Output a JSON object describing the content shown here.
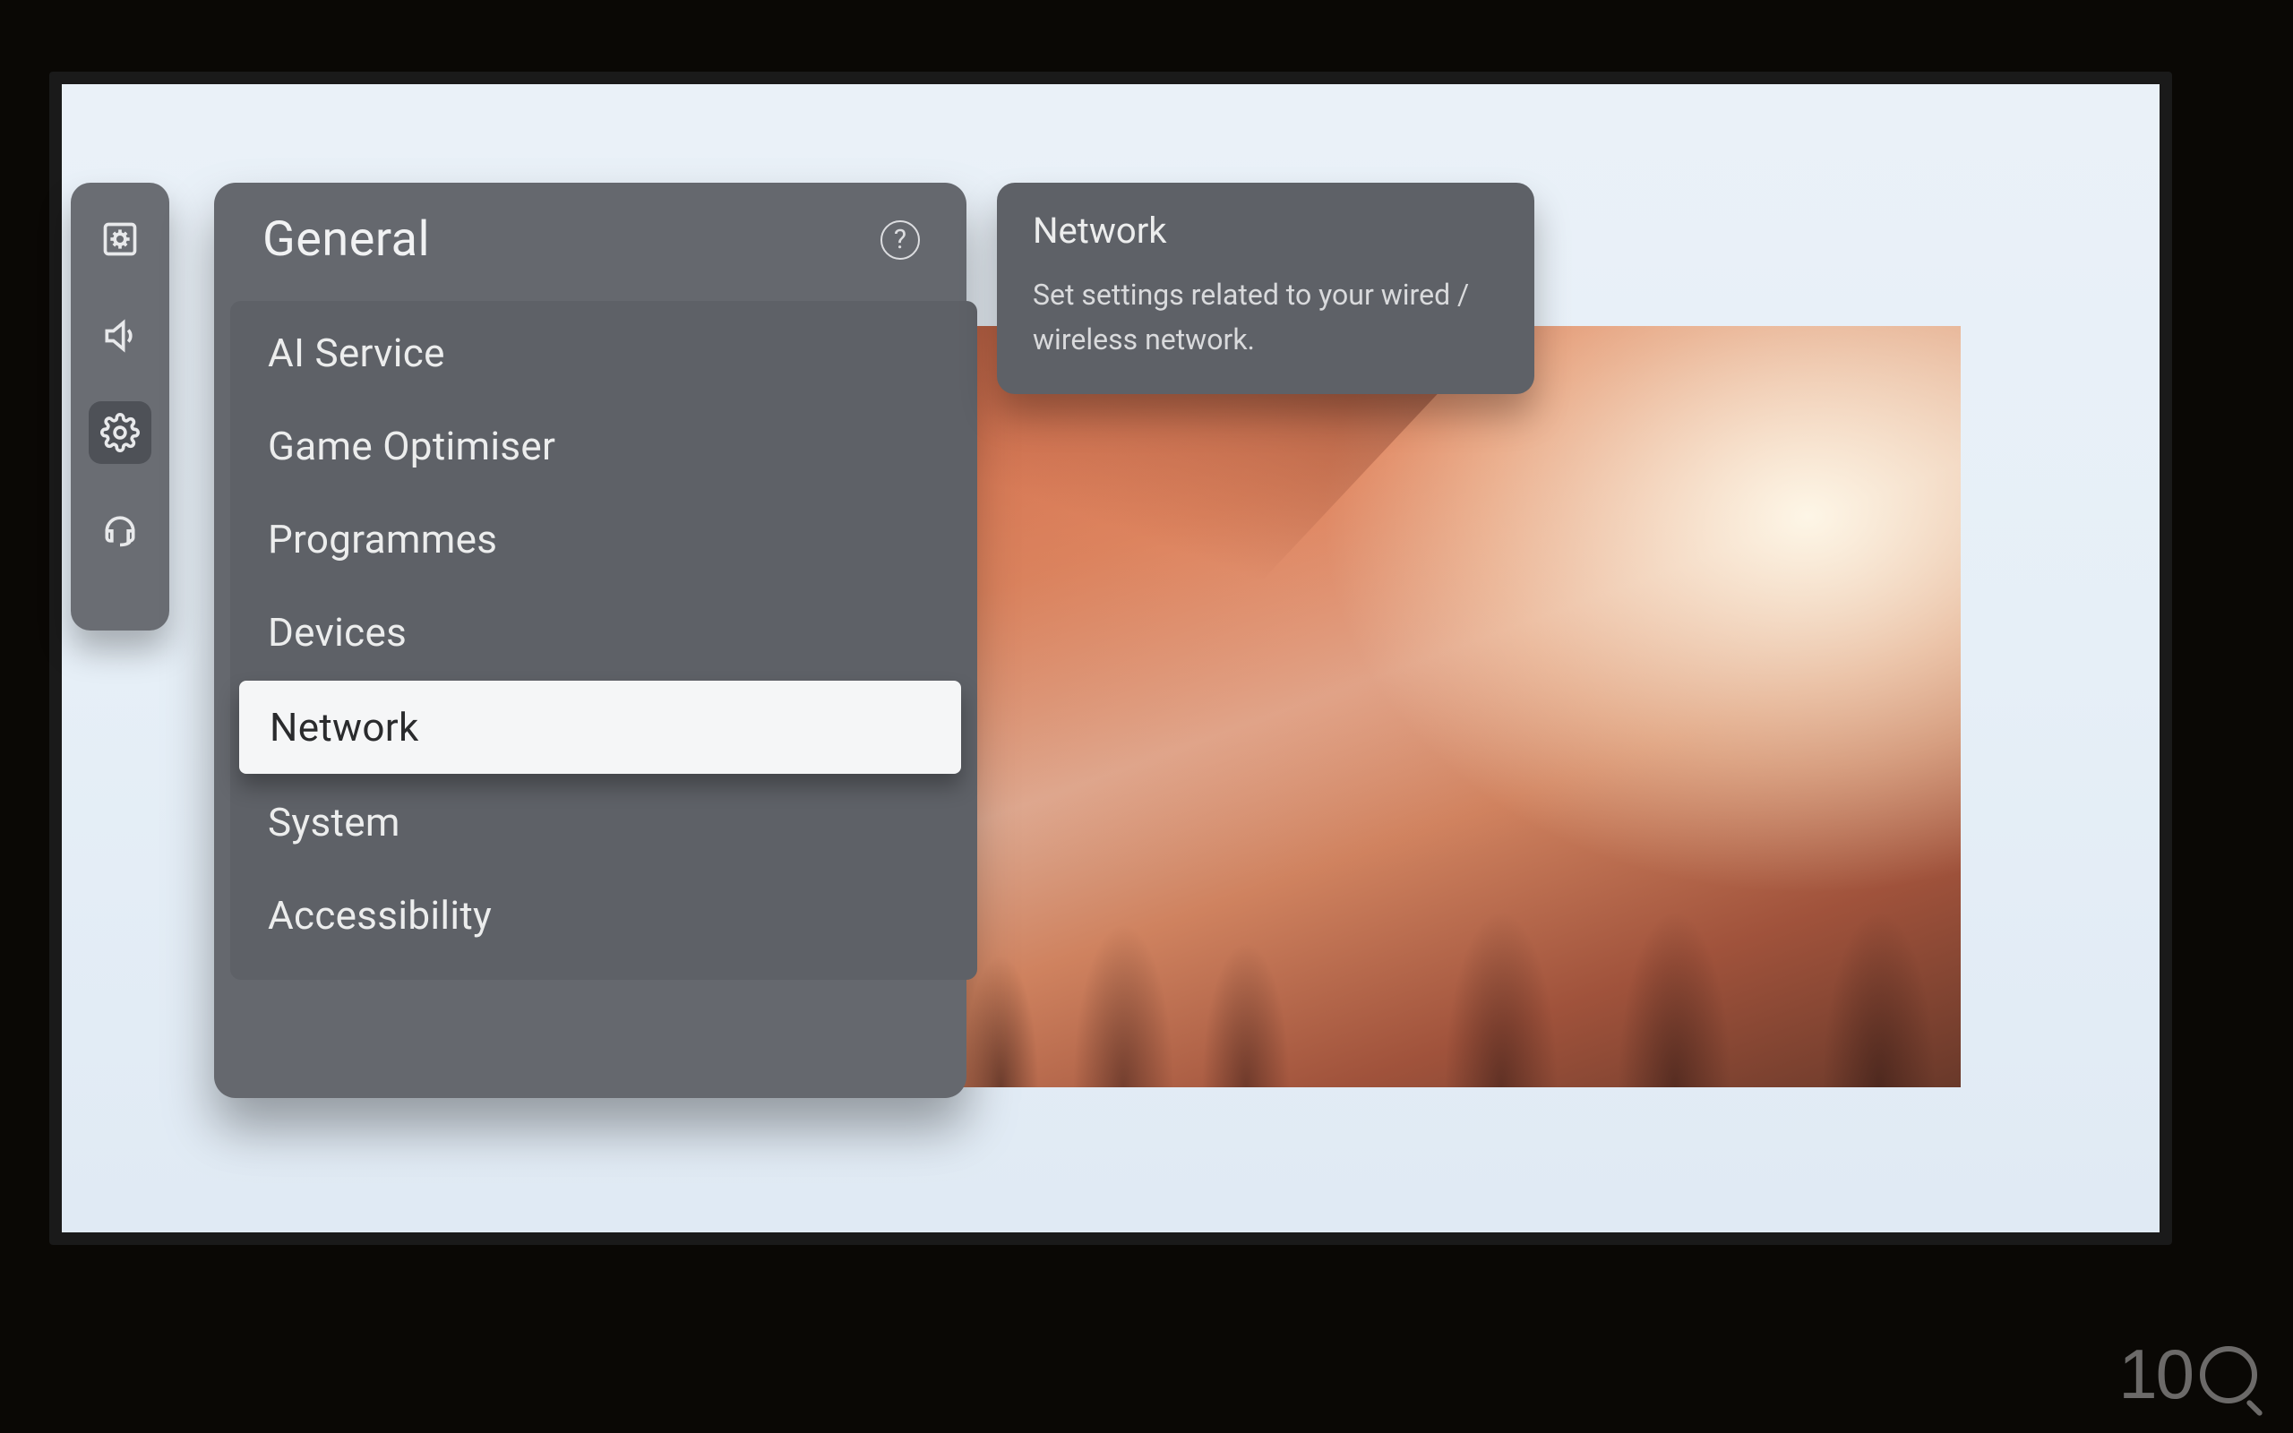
{
  "panel": {
    "title": "General",
    "help_label": "?"
  },
  "sidebar": {
    "icons": [
      {
        "name": "picture-icon",
        "active": false
      },
      {
        "name": "sound-icon",
        "active": false
      },
      {
        "name": "settings-icon",
        "active": true
      },
      {
        "name": "support-icon",
        "active": false
      }
    ]
  },
  "menu": {
    "items": [
      {
        "label": "AI Service",
        "selected": false
      },
      {
        "label": "Game Optimiser",
        "selected": false
      },
      {
        "label": "Programmes",
        "selected": false
      },
      {
        "label": "Devices",
        "selected": false
      },
      {
        "label": "Network",
        "selected": true
      },
      {
        "label": "System",
        "selected": false
      },
      {
        "label": "Accessibility",
        "selected": false
      }
    ]
  },
  "description": {
    "title": "Network",
    "body": "Set settings related to your wired / wireless network."
  },
  "watermark": {
    "text": "10"
  }
}
